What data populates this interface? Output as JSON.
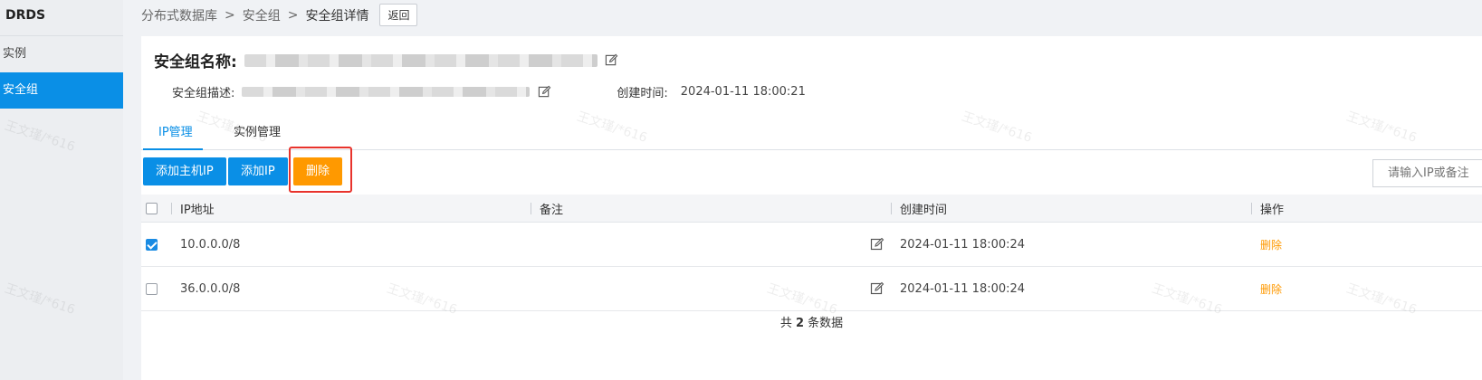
{
  "sidebar": {
    "brand": "DRDS",
    "items": [
      {
        "label": "实例",
        "active": false
      },
      {
        "label": "安全组",
        "active": true
      }
    ]
  },
  "breadcrumb": {
    "items": [
      "分布式数据库",
      "安全组",
      "安全组详情"
    ],
    "separator": ">",
    "back_label": "返回"
  },
  "header": {
    "name_label": "安全组名称:",
    "desc_label": "安全组描述:",
    "created_label": "创建时间:",
    "created_value": "2024-01-11 18:00:21"
  },
  "tabs": [
    {
      "label": "IP管理",
      "active": true
    },
    {
      "label": "实例管理",
      "active": false
    }
  ],
  "toolbar": {
    "add_host_ip": "添加主机IP",
    "add_ip": "添加IP",
    "delete": "删除",
    "search_placeholder": "请输入IP或备注"
  },
  "table": {
    "columns": [
      "IP地址",
      "备注",
      "创建时间",
      "操作"
    ],
    "rows": [
      {
        "checked": true,
        "ip": "10.0.0.0/8",
        "remark": "",
        "created": "2024-01-11 18:00:24",
        "action": "删除"
      },
      {
        "checked": false,
        "ip": "36.0.0.0/8",
        "remark": "",
        "created": "2024-01-11 18:00:24",
        "action": "删除"
      }
    ]
  },
  "footer": {
    "prefix": "共",
    "count": "2",
    "suffix": "条数据"
  },
  "watermark": "王文瑾/*616",
  "colors": {
    "primary": "#0a8fe6",
    "warning": "#ff9900",
    "highlight": "#e8332c"
  }
}
